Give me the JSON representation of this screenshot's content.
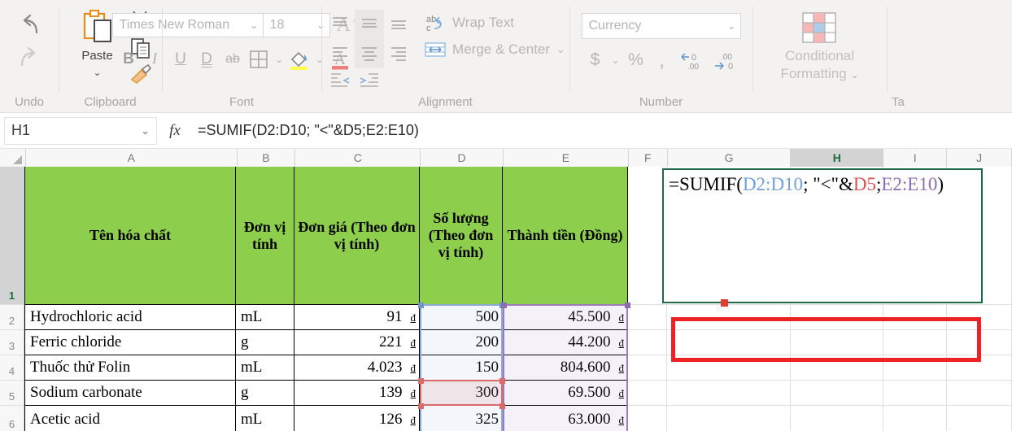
{
  "ribbon": {
    "groups": [
      {
        "name": "undo",
        "label": "Undo"
      },
      {
        "name": "clipboard",
        "label": "Clipboard",
        "paste_label": "Paste"
      },
      {
        "name": "font",
        "label": "Font"
      },
      {
        "name": "alignment",
        "label": "Alignment"
      },
      {
        "name": "number",
        "label": "Number"
      },
      {
        "name": "styles",
        "label": "Ta"
      }
    ],
    "font": {
      "font_name": "Times New Roman",
      "font_size": "18",
      "grow_font": "A",
      "shrink_font": "A",
      "bold": "B",
      "italic": "I",
      "underline": "U",
      "double_underline": "D",
      "strikethrough": "ab"
    },
    "alignment": {
      "wrap_text": "Wrap Text",
      "merge_center": "Merge & Center"
    },
    "number": {
      "format": "Currency",
      "currency": "$",
      "percent": "%",
      "comma": ",",
      "decrease_decimal": ".00",
      "increase_decimal": ".00"
    },
    "styles": {
      "conditional_line1": "Conditional",
      "conditional_line2": "Formatting"
    }
  },
  "formula_bar": {
    "name_box": "H1",
    "fx": "fx",
    "formula": "=SUMIF(D2:D10; \"<\"&D5;E2:E10)"
  },
  "grid": {
    "columns": [
      "A",
      "B",
      "C",
      "D",
      "E",
      "F",
      "G",
      "H",
      "I",
      "J"
    ],
    "selected_column": "H",
    "rows": [
      "1",
      "2",
      "3",
      "4",
      "5",
      "6"
    ],
    "selected_row": "1",
    "header_fill": "#8DCE4C",
    "headers": {
      "A": "Tên hóa chất",
      "B": "Đơn vị tính",
      "C": "Đơn giá (Theo đơn vị tính)",
      "D": "Số lượng (Theo đơn vị tính)",
      "E": "Thành tiền (Đồng)"
    },
    "data": [
      {
        "row": "2",
        "name": "Hydrochloric acid",
        "unit": "mL",
        "price": "91",
        "qty": "500",
        "total": "45.500",
        "sym": "đ"
      },
      {
        "row": "3",
        "name": "Ferric chloride",
        "unit": "g",
        "price": "221",
        "qty": "200",
        "total": "44.200",
        "sym": "đ"
      },
      {
        "row": "4",
        "name": "Thuốc thử Folin",
        "unit": "mL",
        "price": "4.023",
        "qty": "150",
        "total": "804.600",
        "sym": "đ"
      },
      {
        "row": "5",
        "name": "Sodium carbonate",
        "unit": "g",
        "price": "139",
        "qty": "300",
        "total": "69.500",
        "sym": "đ"
      },
      {
        "row": "6",
        "name": "Acetic acid",
        "unit": "mL",
        "price": "126",
        "qty": "325",
        "total": "63.000",
        "sym": "đ"
      }
    ]
  },
  "cell_editor": {
    "prefix": "=SUMIF(",
    "ref1": "D2:D10",
    "mid1": "; \"<\"&",
    "ref2": "D5",
    "mid2": ";",
    "ref3": "E2:E10",
    "suffix": ")",
    "ref1_color": "#6f9fe0",
    "ref2_color": "#d9534f",
    "ref3_color": "#8a6db3",
    "border_color": "#1f6b45",
    "annotation_color": "#ee2222"
  }
}
